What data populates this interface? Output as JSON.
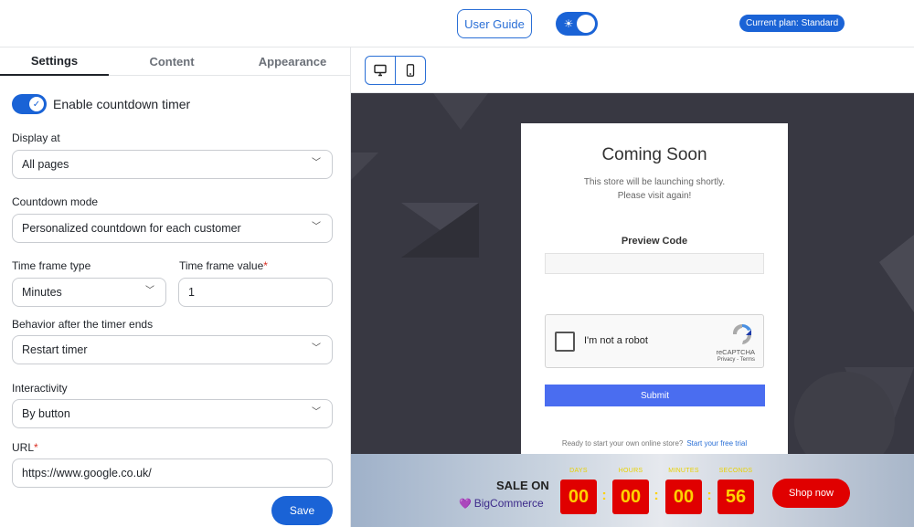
{
  "header": {
    "user_guide": "User Guide",
    "current_plan": "Current plan: Standard"
  },
  "tabs": [
    {
      "label": "Settings",
      "active": true
    },
    {
      "label": "Content",
      "active": false
    },
    {
      "label": "Appearance",
      "active": false
    }
  ],
  "settings": {
    "enable_label": "Enable countdown timer",
    "enable_on": true,
    "display_at": {
      "label": "Display at",
      "value": "All pages"
    },
    "countdown_mode": {
      "label": "Countdown mode",
      "value": "Personalized countdown for each customer"
    },
    "time_frame_type": {
      "label": "Time frame type",
      "value": "Minutes"
    },
    "time_frame_value": {
      "label": "Time frame value",
      "required_mark": "*",
      "value": "1"
    },
    "behavior": {
      "label": "Behavior after the timer ends",
      "value": "Restart timer"
    },
    "interactivity": {
      "label": "Interactivity",
      "value": "By button"
    },
    "url": {
      "label": "URL",
      "required_mark": "*",
      "value": "https://www.google.co.uk/"
    },
    "save": "Save"
  },
  "preview": {
    "device_selected": "desktop",
    "title": "Coming Soon",
    "line1": "This store will be launching shortly.",
    "line2": "Please visit again!",
    "preview_code": "Preview Code",
    "captcha_text": "I'm not a robot",
    "captcha_brand": "reCAPTCHA",
    "captcha_links": "Privacy - Terms",
    "submit": "Submit",
    "ready_text": "Ready to start your own online store?",
    "trial_link": "Start your free trial"
  },
  "countdown": {
    "sale_on": "SALE ON",
    "brand": "BigCommerce",
    "days_label": "DAYS",
    "days": "00",
    "hours_label": "HOURS",
    "hours": "00",
    "minutes_label": "MINUTES",
    "minutes": "00",
    "seconds_label": "SECONDS",
    "seconds": "56",
    "separator": ":",
    "shop_now": "Shop now"
  },
  "colors": {
    "accent": "#1a63d6",
    "timer_red": "#e00000",
    "timer_digit": "#ffd200",
    "stage_bg": "#383842"
  }
}
